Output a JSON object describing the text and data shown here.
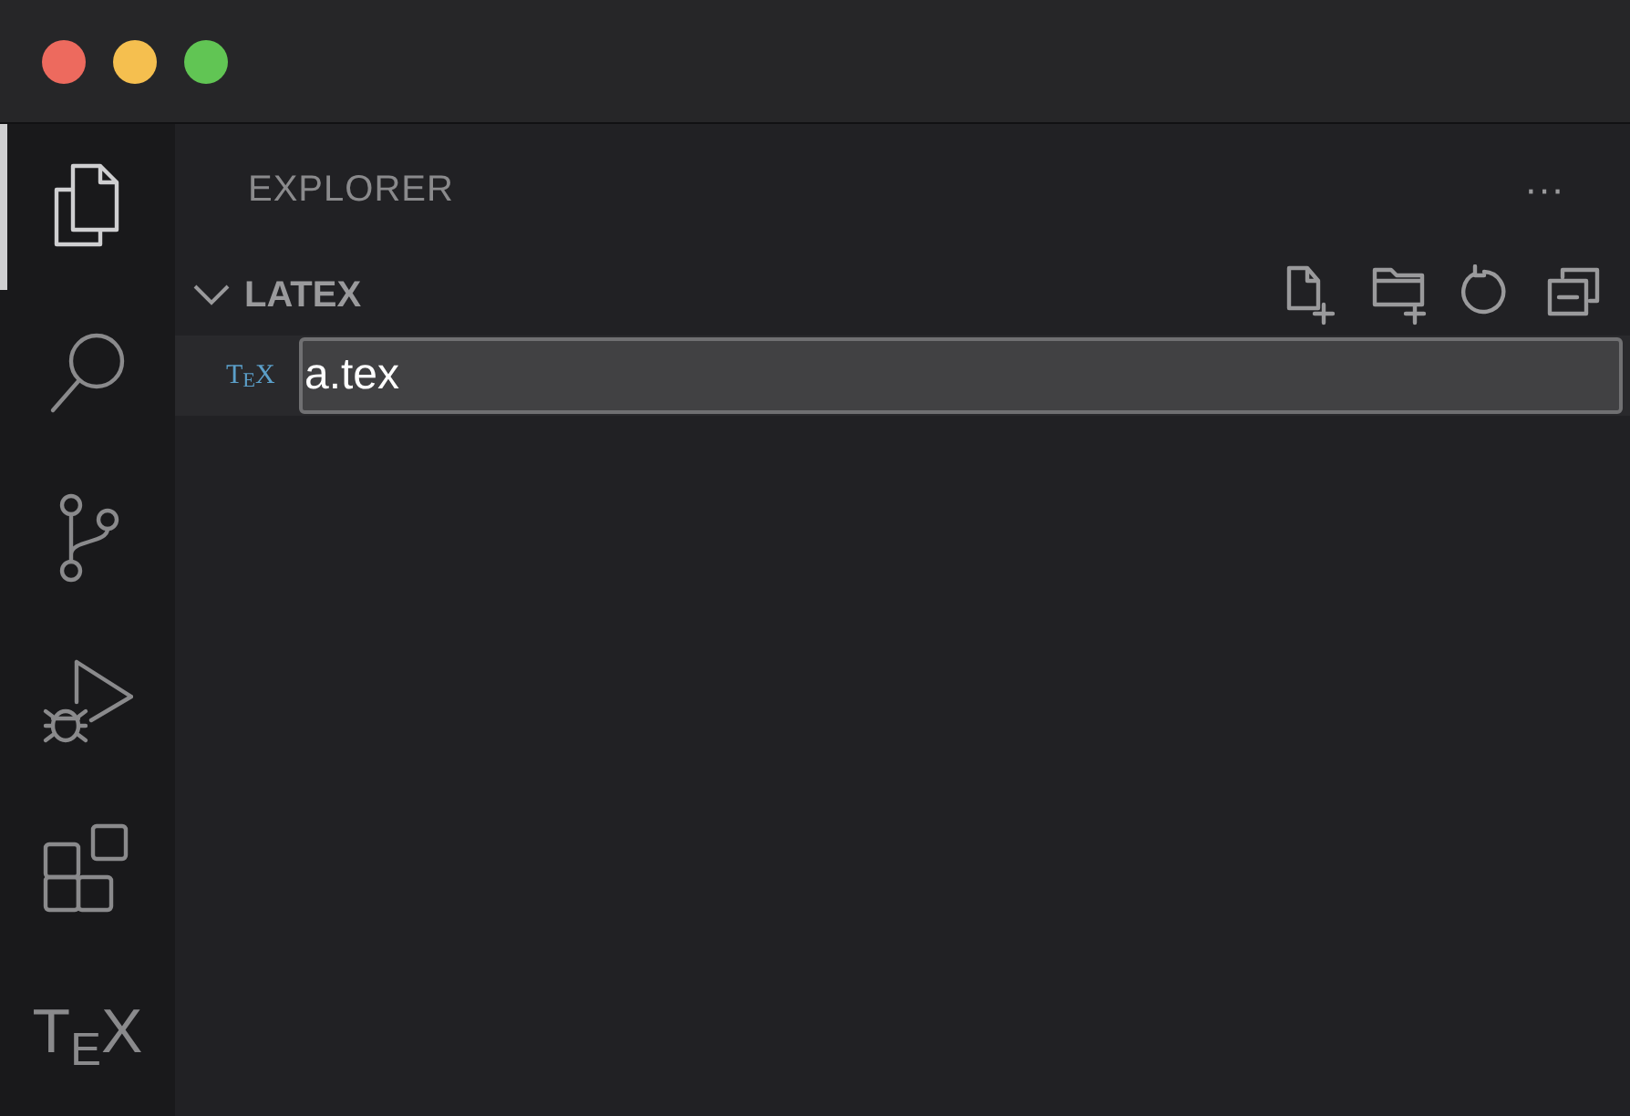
{
  "window_controls": [
    {
      "color": "#ed6a5e"
    },
    {
      "color": "#f5bf4f"
    },
    {
      "color": "#61c554"
    }
  ],
  "activity_bar": [
    {
      "kind": "explorer",
      "selected": true
    },
    {
      "kind": "search",
      "selected": false
    },
    {
      "kind": "source-control",
      "selected": false
    },
    {
      "kind": "run-debug",
      "selected": false
    },
    {
      "kind": "extensions",
      "selected": false
    },
    {
      "kind": "tex",
      "label": "T$_{E}$X",
      "selected": false
    }
  ],
  "sidebar": {
    "title": "EXPLORER",
    "more": "···",
    "section": {
      "title": "LATEX",
      "expanded": true,
      "actions": [
        {
          "kind": "new-file"
        },
        {
          "kind": "new-folder"
        },
        {
          "kind": "refresh"
        },
        {
          "kind": "collapse"
        }
      ]
    },
    "rename_row": {
      "icon_label": "T$_{E}$X",
      "value": "a.tex"
    }
  }
}
